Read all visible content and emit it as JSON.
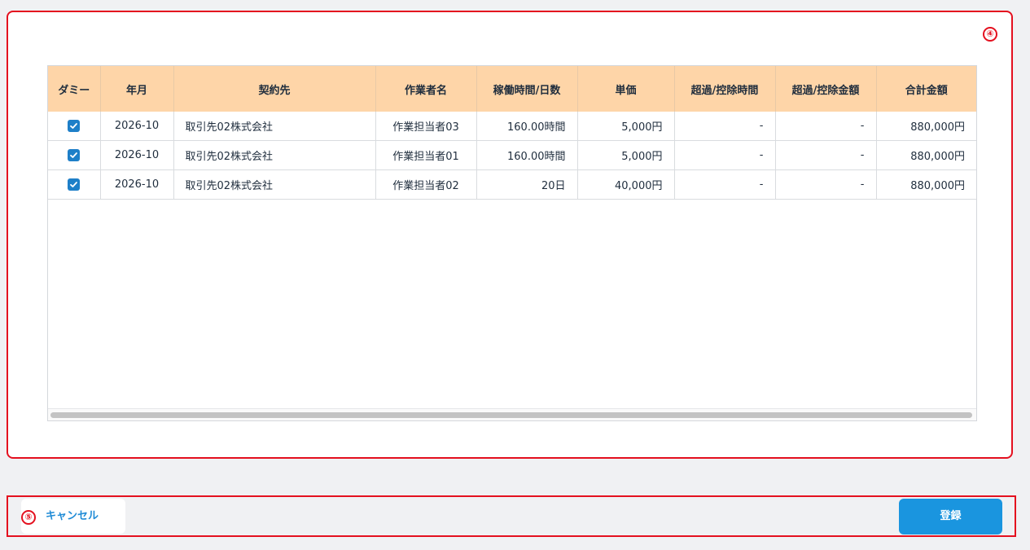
{
  "annotations": {
    "panel_marker": "④",
    "footer_marker": "⑤"
  },
  "table": {
    "headers": [
      "ダミー",
      "年月",
      "契約先",
      "作業者名",
      "稼働時間/日数",
      "単価",
      "超過/控除時間",
      "超過/控除金額",
      "合計金額"
    ],
    "rows": [
      {
        "checked": true,
        "month": "2026-10",
        "client": "取引先02株式会社",
        "worker": "作業担当者03",
        "hours": "160.00時間",
        "unit_price": "5,000円",
        "over_time": "-",
        "over_amount": "-",
        "total": "880,000円"
      },
      {
        "checked": true,
        "month": "2026-10",
        "client": "取引先02株式会社",
        "worker": "作業担当者01",
        "hours": "160.00時間",
        "unit_price": "5,000円",
        "over_time": "-",
        "over_amount": "-",
        "total": "880,000円"
      },
      {
        "checked": true,
        "month": "2026-10",
        "client": "取引先02株式会社",
        "worker": "作業担当者02",
        "hours": "20日",
        "unit_price": "40,000円",
        "over_time": "-",
        "over_amount": "-",
        "total": "880,000円"
      }
    ]
  },
  "footer": {
    "cancel_label": "キャンセル",
    "submit_label": "登録"
  },
  "colors": {
    "header_bg": "#fed5a8",
    "accent_red": "#e4101f",
    "checkbox_blue": "#1e7fc8",
    "submit_blue": "#1a95df",
    "link_blue": "#1f8bd6"
  }
}
